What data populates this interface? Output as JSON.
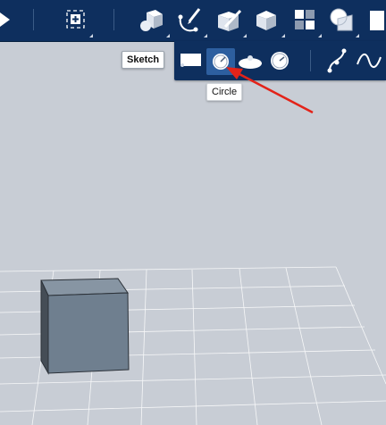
{
  "colors": {
    "toolbar_bg": "#0e2f5e",
    "canvas_bg": "#c8cdd5",
    "grid_line": "#ffffff",
    "box_front": "#6f7f8f",
    "box_top": "#8795a3",
    "box_side": "#454d56",
    "selected_tool": "#2d5f9f",
    "annotation_arrow": "#e32319"
  },
  "toolbar": {
    "icons": [
      "play-icon",
      "snap-grid-icon",
      "primitives-icon",
      "sketch-icon",
      "construct-icon",
      "modify-icon",
      "pattern-icon",
      "combine-icon",
      "measure-icon"
    ]
  },
  "sketch_menu": {
    "tools": [
      "rectangle-tool-icon",
      "circle-tool-icon",
      "ellipse-tool-icon",
      "polygon-tool-icon",
      "polyline-tool-icon",
      "spline-tool-icon"
    ],
    "selected": "circle-tool-icon"
  },
  "tooltips": {
    "sketch": "Sketch",
    "circle": "Circle"
  }
}
